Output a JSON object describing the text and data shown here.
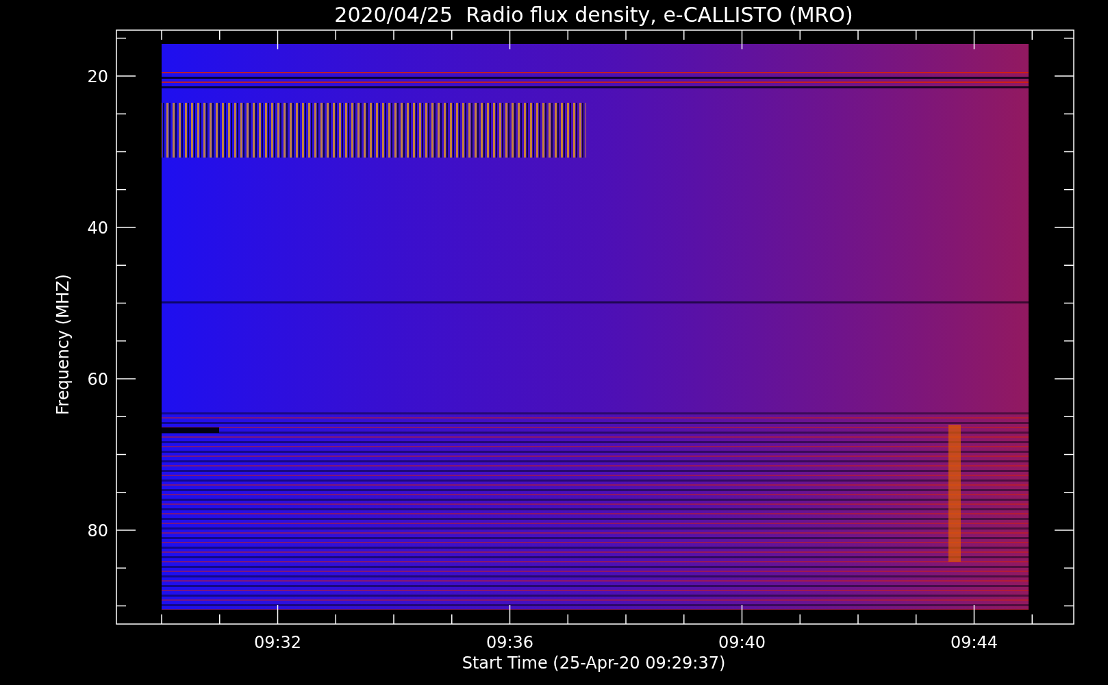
{
  "title": "2020/04/25  Radio flux density, e-CALLISTO (MRO)",
  "y_axis": {
    "label": "Frequency (MHZ)",
    "ticks": [
      "20",
      "40",
      "60",
      "80"
    ]
  },
  "x_axis": {
    "label": "Start Time (25-Apr-20 09:29:37)",
    "ticks": [
      "09:32",
      "09:36",
      "09:40",
      "09:44"
    ]
  }
}
